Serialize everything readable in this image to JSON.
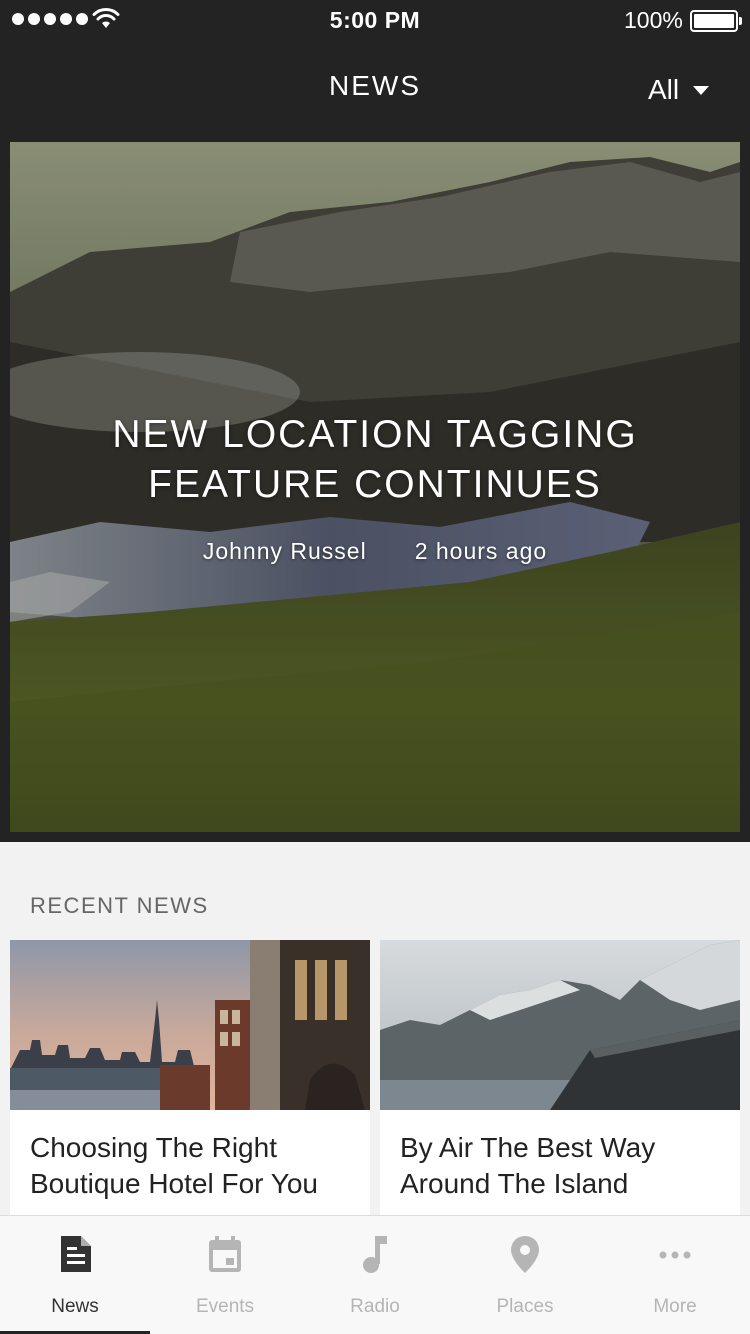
{
  "status_bar": {
    "time": "5:00 PM",
    "battery": "100%"
  },
  "header": {
    "title": "NEWS",
    "filter_label": "All"
  },
  "featured": {
    "title_line1": "NEW LOCATION TAGGING",
    "title_line2": "FEATURE CONTINUES",
    "author": "Johnny Russel",
    "time_ago": "2 hours ago"
  },
  "recent": {
    "section_label": "RECENT NEWS",
    "items": [
      {
        "title": "Choosing The Right Boutique Hotel For You"
      },
      {
        "title": "By Air The Best Way Around The Island"
      }
    ]
  },
  "tab_bar": {
    "tabs": [
      {
        "label": "News",
        "icon": "document-icon",
        "active": true
      },
      {
        "label": "Events",
        "icon": "calendar-icon",
        "active": false
      },
      {
        "label": "Radio",
        "icon": "music-note-icon",
        "active": false
      },
      {
        "label": "Places",
        "icon": "location-pin-icon",
        "active": false
      },
      {
        "label": "More",
        "icon": "more-dots-icon",
        "active": false
      }
    ]
  },
  "colors": {
    "header_bg": "#232323",
    "page_bg": "#f2f2f2",
    "tab_active": "#333333",
    "tab_inactive": "#b5b5b5"
  }
}
